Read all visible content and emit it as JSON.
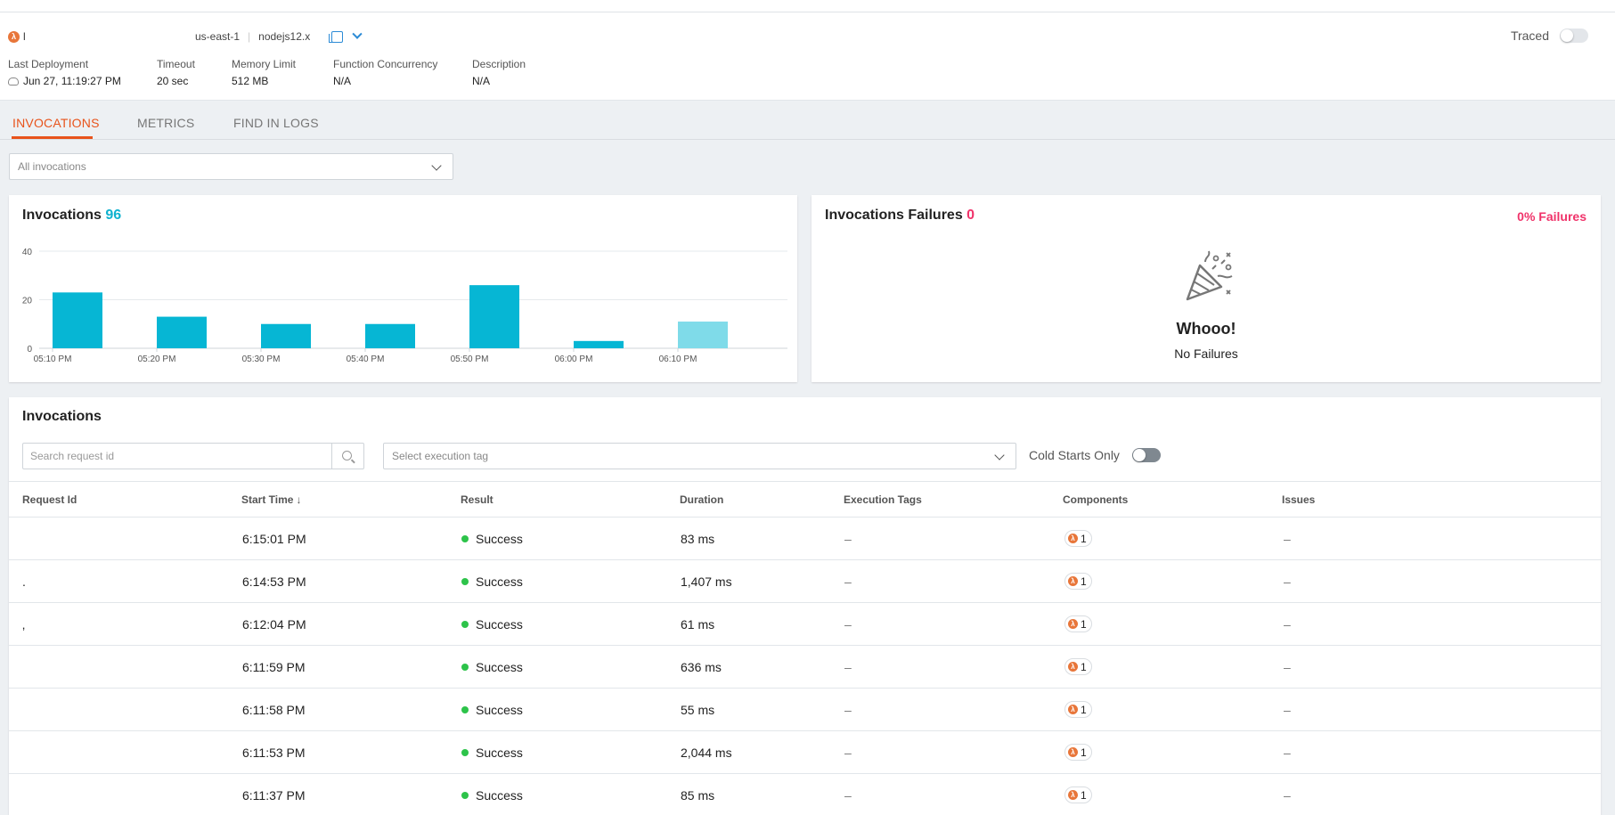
{
  "function": {
    "name": "l",
    "region": "us-east-1",
    "runtime": "nodejs12.x",
    "traced_label": "Traced",
    "meta": [
      {
        "label": "Last Deployment",
        "value": "Jun 27, 11:19:27 PM"
      },
      {
        "label": "Timeout",
        "value": "20 sec"
      },
      {
        "label": "Memory Limit",
        "value": "512 MB"
      },
      {
        "label": "Function Concurrency",
        "value": "N/A"
      },
      {
        "label": "Description",
        "value": "N/A"
      }
    ]
  },
  "tabs": [
    {
      "label": "INVOCATIONS",
      "active": true
    },
    {
      "label": "METRICS",
      "active": false
    },
    {
      "label": "FIND IN LOGS",
      "active": false
    }
  ],
  "filter": {
    "selected": "All invocations"
  },
  "invocations_card": {
    "title": "Invocations",
    "count": "96"
  },
  "failures_card": {
    "title": "Invocations Failures",
    "count": "0",
    "percent": "0% Failures",
    "headline": "Whooo!",
    "subtext": "No Failures"
  },
  "chart_data": {
    "type": "bar",
    "categories": [
      "05:10 PM",
      "05:20 PM",
      "05:30 PM",
      "05:40 PM",
      "05:50 PM",
      "06:00 PM",
      "06:10 PM"
    ],
    "x_tick_labels": [
      "05:10 PM",
      "05:20 PM",
      "05:30 PM",
      "05:40 PM",
      "05:50 PM",
      "06:00 PM",
      "06:10 PM"
    ],
    "values": [
      23,
      13,
      10,
      10,
      26,
      3,
      11
    ],
    "y_ticks": [
      0,
      20,
      40
    ],
    "ylim": [
      0,
      40
    ],
    "grid": true,
    "bar_color": "#06b6d4",
    "last_bar_color": "#7fdbe9"
  },
  "table": {
    "title": "Invocations",
    "search_placeholder": "Search request id",
    "tag_placeholder": "Select execution tag",
    "cold_starts_label": "Cold Starts Only",
    "columns": [
      "Request Id",
      "Start Time",
      "Result",
      "Duration",
      "Execution Tags",
      "Components",
      "Issues"
    ],
    "sort_arrow": "↓",
    "rows": [
      {
        "request_id": "",
        "start": "6:15:01 PM",
        "result": "Success",
        "duration": "83 ms",
        "tags": "–",
        "components": "1",
        "issues": "–"
      },
      {
        "request_id": ".",
        "start": "6:14:53 PM",
        "result": "Success",
        "duration": "1,407 ms",
        "tags": "–",
        "components": "1",
        "issues": "–"
      },
      {
        "request_id": "‚",
        "start": "6:12:04 PM",
        "result": "Success",
        "duration": "61 ms",
        "tags": "–",
        "components": "1",
        "issues": "–"
      },
      {
        "request_id": "",
        "start": "6:11:59 PM",
        "result": "Success",
        "duration": "636 ms",
        "tags": "–",
        "components": "1",
        "issues": "–"
      },
      {
        "request_id": "",
        "start": "6:11:58 PM",
        "result": "Success",
        "duration": "55 ms",
        "tags": "–",
        "components": "1",
        "issues": "–"
      },
      {
        "request_id": "",
        "start": "6:11:53 PM",
        "result": "Success",
        "duration": "2,044 ms",
        "tags": "–",
        "components": "1",
        "issues": "–"
      },
      {
        "request_id": "",
        "start": "6:11:37 PM",
        "result": "Success",
        "duration": "85 ms",
        "tags": "–",
        "components": "1",
        "issues": "–"
      }
    ]
  }
}
